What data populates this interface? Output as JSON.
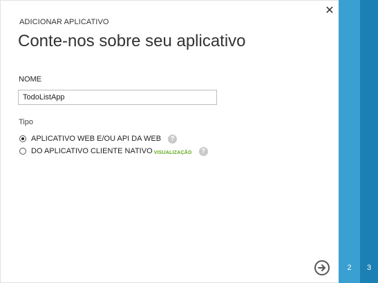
{
  "dialog": {
    "subtitle": "ADICIONAR APLICATIVO",
    "title": "Conte-nos sobre seu aplicativo",
    "close_glyph": "✕"
  },
  "form": {
    "name_label": "NOME",
    "name_value": "TodoListApp",
    "type_label": "Tipo",
    "options": [
      {
        "label": "APLICATIVO WEB E/OU API DA WEB",
        "selected": true,
        "help_icon": "question-icon"
      },
      {
        "label": "DO APLICATIVO CLIENTE NATIVO",
        "badge": "VISUALIZAÇÃO",
        "selected": false,
        "help_icon": "question-icon"
      }
    ],
    "help_glyph": "?"
  },
  "navigation": {
    "next_icon": "arrow-right-icon"
  },
  "steps": [
    {
      "number": "2",
      "color": "#3aa0d1"
    },
    {
      "number": "3",
      "color": "#1b80b4"
    }
  ],
  "colors": {
    "badge": "#5fa81c",
    "help_icon": "#c9c9c9"
  }
}
